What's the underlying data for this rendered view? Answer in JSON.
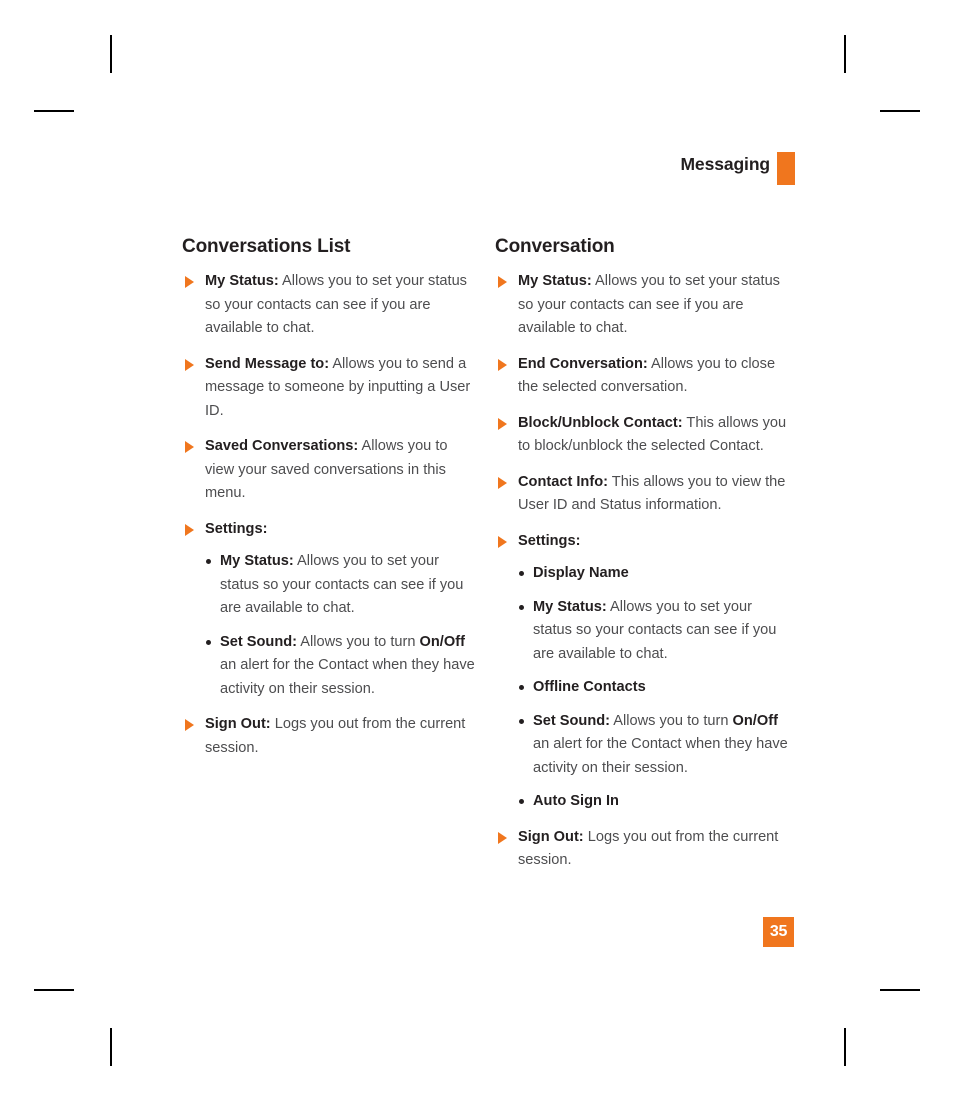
{
  "header": {
    "title": "Messaging",
    "tab_color": "#F0761E"
  },
  "page_number": "35",
  "accent_color": "#F0761E",
  "columns": [
    {
      "title": "Conversations List",
      "items": [
        {
          "term": "My Status:",
          "desc": " Allows you to set your status so your contacts can see if you are available to chat."
        },
        {
          "term": "Send Message to:",
          "desc": " Allows you to send a message to someone by inputting a User ID."
        },
        {
          "term": "Saved Conversations:",
          "desc": " Allows you to view your saved conversations in this menu."
        },
        {
          "term": "Settings:",
          "desc": "",
          "subitems": [
            {
              "term": "My Status:",
              "desc": " Allows you to set your status so your contacts can see if you are available to chat."
            },
            {
              "term": "Set Sound:",
              "desc": " Allows you to turn ",
              "emphasis": "On/Off",
              "desc2": " an alert for the Contact when they have activity on their session."
            }
          ]
        },
        {
          "term": "Sign Out:",
          "desc": " Logs you out from the current session."
        }
      ]
    },
    {
      "title": "Conversation",
      "items": [
        {
          "term": "My Status:",
          "desc": " Allows you to set your status so your contacts can see if you are available to chat."
        },
        {
          "term": "End Conversation:",
          "desc": " Allows you to close the selected conversation."
        },
        {
          "term": "Block/Unblock Contact:",
          "desc": " This allows you to block/unblock the selected Contact."
        },
        {
          "term": "Contact Info:",
          "desc": " This allows you to view the User ID and Status information."
        },
        {
          "term": "Settings:",
          "desc": "",
          "subitems": [
            {
              "term": "Display Name",
              "desc": ""
            },
            {
              "term": "My Status:",
              "desc": " Allows you to set your status so your contacts can see if you are available to chat."
            },
            {
              "term": "Offline Contacts",
              "desc": ""
            },
            {
              "term": "Set Sound:",
              "desc": " Allows you to turn ",
              "emphasis": "On/Off",
              "desc2": " an alert for the Contact when they have activity on their session."
            },
            {
              "term": "Auto Sign In",
              "desc": ""
            }
          ]
        },
        {
          "term": "Sign Out:",
          "desc": " Logs you out from the current session."
        }
      ]
    }
  ]
}
